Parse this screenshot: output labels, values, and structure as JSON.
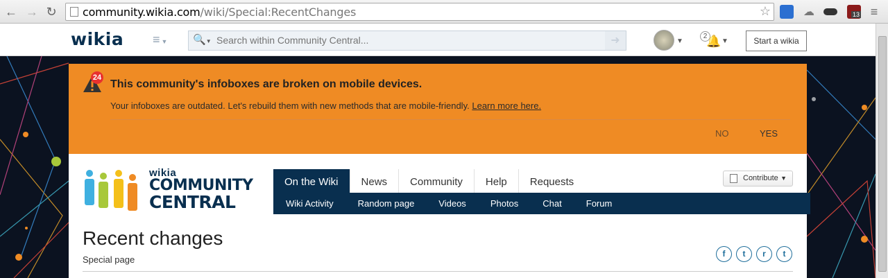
{
  "browser": {
    "url_host": "community.wikia.com",
    "url_path": "/wiki/Special:RecentChanges",
    "extension_badge": "13"
  },
  "global_nav": {
    "wordmark": "wikia",
    "search_placeholder": "Search within Community Central...",
    "notification_count": "2",
    "start_wikia_label": "Start a wikia"
  },
  "banner": {
    "count": "24",
    "title": "This community's infoboxes are broken on mobile devices.",
    "message": "Your infoboxes are outdated. Let's rebuild them with new methods that are mobile-friendly.",
    "link": "Learn more here.",
    "no_label": "NO",
    "yes_label": "YES",
    "color": "#ef8b24"
  },
  "wiki": {
    "logo_small": "wikia",
    "logo_line1": "COMMUNITY",
    "logo_line2": "CENTRAL",
    "tabs": [
      "On the Wiki",
      "News",
      "Community",
      "Help",
      "Requests"
    ],
    "subnav": [
      "Wiki Activity",
      "Random page",
      "Videos",
      "Photos",
      "Chat",
      "Forum"
    ],
    "contribute_label": "Contribute",
    "accent": "#092f4f"
  },
  "page": {
    "title": "Recent changes",
    "subtitle": "Special page"
  }
}
